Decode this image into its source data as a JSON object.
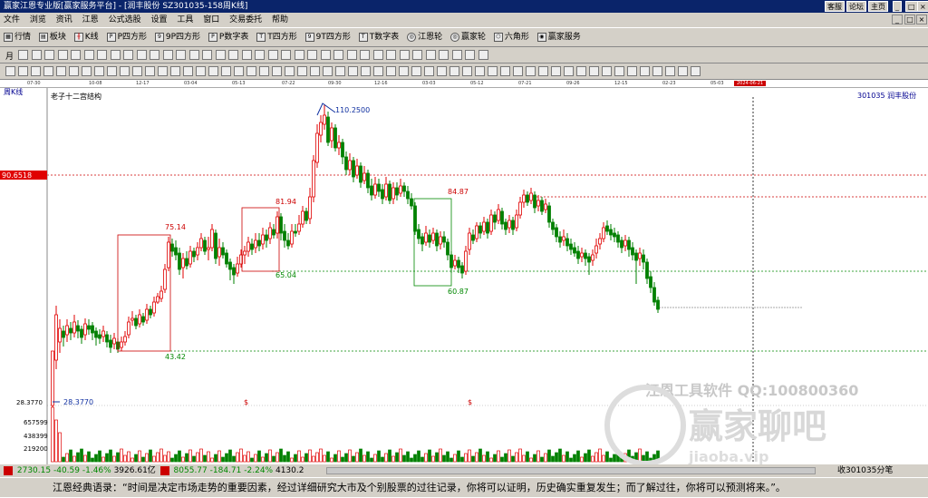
{
  "window": {
    "title": "赢家江恩专业版[赢家服务平台] - [润丰股份  SZ301035-158周K线]",
    "btn_register": "客服",
    "btn_forum": "论坛",
    "btn_home": "主页",
    "controls": [
      "_",
      "□",
      "×"
    ]
  },
  "menu": [
    "文件",
    "浏览",
    "资讯",
    "江恩",
    "公式选股",
    "设置",
    "工具",
    "窗口",
    "交易委托",
    "帮助"
  ],
  "toolbar": [
    {
      "label": "行情",
      "icon": "market-icon"
    },
    {
      "label": "板块",
      "icon": "sector-icon"
    },
    {
      "label": "K线",
      "icon": "kline-icon"
    },
    {
      "label": "P四方形",
      "icon": "square-icon"
    },
    {
      "label": "9P四方形",
      "icon": "square-icon"
    },
    {
      "label": "P数字表",
      "icon": "table-icon"
    },
    {
      "label": "T四方形",
      "icon": "square-icon"
    },
    {
      "label": "9T四方形",
      "icon": "square-icon"
    },
    {
      "label": "T数字表",
      "icon": "table-icon"
    },
    {
      "label": "江恩轮",
      "icon": "wheel-icon"
    },
    {
      "label": "赢家轮",
      "icon": "wheel-icon"
    },
    {
      "label": "六角形",
      "icon": "hexagon-icon"
    },
    {
      "label": "赢家服务",
      "icon": "service-icon"
    }
  ],
  "period": "月",
  "dates": [
    "07-30",
    "10-08",
    "12-17",
    "03-04",
    "05-13",
    "07-22",
    "09-30",
    "12-16",
    "03-03",
    "05-12",
    "07-21",
    "09-26",
    "12-15",
    "02-23",
    "05-03",
    "2024-06-21"
  ],
  "chart": {
    "period_label": "周K线",
    "indicator": "老子十二宫结构",
    "stock": "301035  润丰股份",
    "price_label": "90.6518",
    "scale": [
      "28.3770",
      "657599",
      "438399",
      "219200"
    ],
    "watermark1": "江恩工具软件   QQ:100800360",
    "watermark2": "赢家聊吧",
    "watermark3": "jiaoba.vip"
  },
  "chart_data": {
    "type": "candlestick",
    "annotations": [
      "110.2500",
      "75.14",
      "81.94",
      "84.87",
      "65.04",
      "60.87",
      "43.42",
      "28.3770",
      "$",
      "$"
    ]
  },
  "status": {
    "sh": "2730.15",
    "sh_chg": "-40.59",
    "sh_pct": "-1.46%",
    "sh_amt": "3926.61亿",
    "sz": "8055.77",
    "sz_chg": "-184.71",
    "sz_pct": "-2.24%",
    "sz_amt": "4130.2",
    "right": "收301035分笔"
  },
  "quote": "江恩经典语录：“时间是决定市场走势的重要因素，经过详细研究大市及个别股票的过往记录，你将可以证明，历史确实重复发生；而了解过往，你将可以预测将来。”。"
}
